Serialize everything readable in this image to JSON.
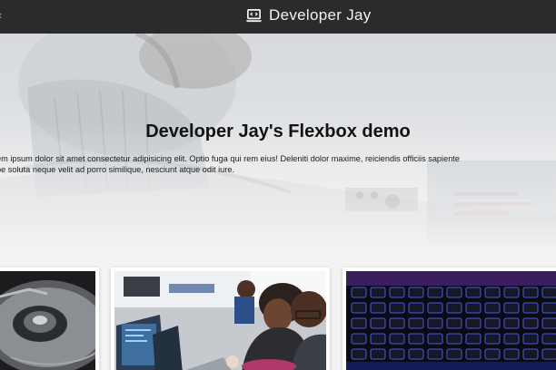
{
  "header": {
    "brand_title": "Developer Jay",
    "brand_icon": "laptop-code-icon",
    "background": "#2b2b2d",
    "text_color": "#f2f2f2"
  },
  "hero": {
    "title": "Developer Jay's Flexbox demo",
    "paragraph_lines": [
      "em ipsum dolor sit amet consectetur adipisicing elit. Optio fuga qui rem eius! Deleniti dolor maxime, reiciendis officiis sapiente",
      "pe soluta neque velit ad porro similique, nesciunt atque odit iure."
    ]
  },
  "cards": [
    {
      "image": "hard-drive-photo"
    },
    {
      "image": "developers-at-laptops-photo"
    },
    {
      "image": "backlit-keyboard-photo"
    }
  ]
}
